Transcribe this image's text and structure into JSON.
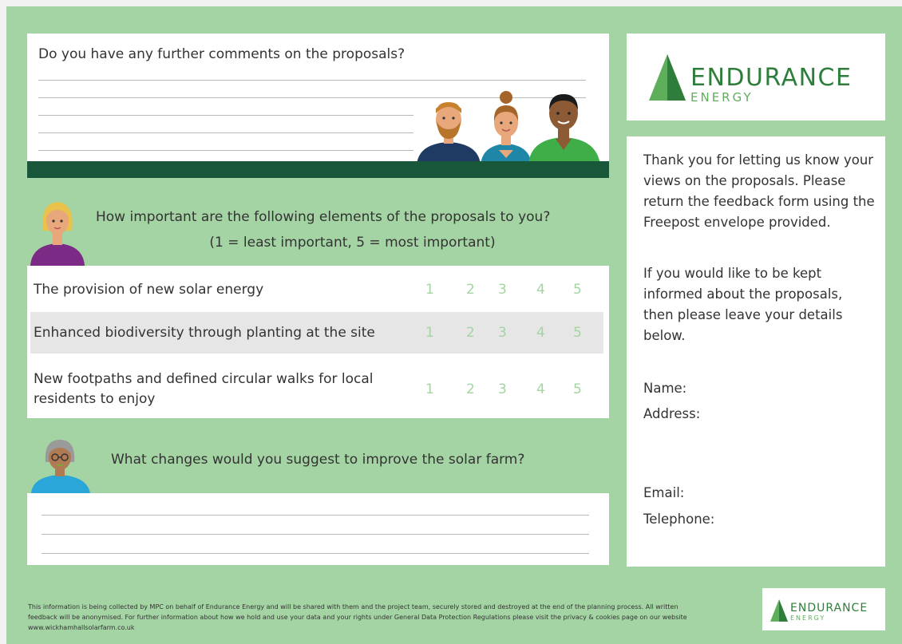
{
  "comments": {
    "question": "Do you have any further comments on the proposals?"
  },
  "importance": {
    "title": "How important are the following elements of the proposals to you?",
    "scale": "(1 = least important, 5 = most important)",
    "rows": [
      {
        "label": "The provision of new solar energy",
        "values": [
          "1",
          "2",
          "3",
          "4",
          "5"
        ]
      },
      {
        "label": "Enhanced biodiversity through planting at the site",
        "values": [
          "1",
          "2",
          "3",
          "4",
          "5"
        ]
      },
      {
        "label_line1": "New footpaths and defined circular walks for local",
        "label_line2": "residents to enjoy",
        "values": [
          "1",
          "2",
          "3",
          "4",
          "5"
        ]
      }
    ]
  },
  "changes": {
    "question": "What changes would you suggest to improve the solar farm?"
  },
  "logo": {
    "main": "ENDURANCE",
    "sub": "ENERGY"
  },
  "info": {
    "para1": "Thank you for letting us know your views on the proposals. Please return the feedback form using the Freepost envelope provided.",
    "para2": "If you would like to be kept informed about the proposals, then please leave your details below.",
    "name_label": "Name:",
    "address_label": "Address:",
    "email_label": "Email:",
    "telephone_label": "Telephone:"
  },
  "footer": {
    "line1": "This information is being collected by MPC on behalf of Endurance Energy and will be shared with them and the project team, securely stored and destroyed at the end of the planning process. All written",
    "line2": "feedback will be anonymised. For further information about how we hold and use your data and your rights under General Data Protection Regulations please visit the privacy & cookies page on our website",
    "line3": "www.wickhamhallsolarfarm.co.uk"
  },
  "colors": {
    "page_green": "#a4d4a3",
    "dark_green": "#19573a",
    "brand_green": "#2e7d3a",
    "scale_green": "#a4d4a3"
  }
}
